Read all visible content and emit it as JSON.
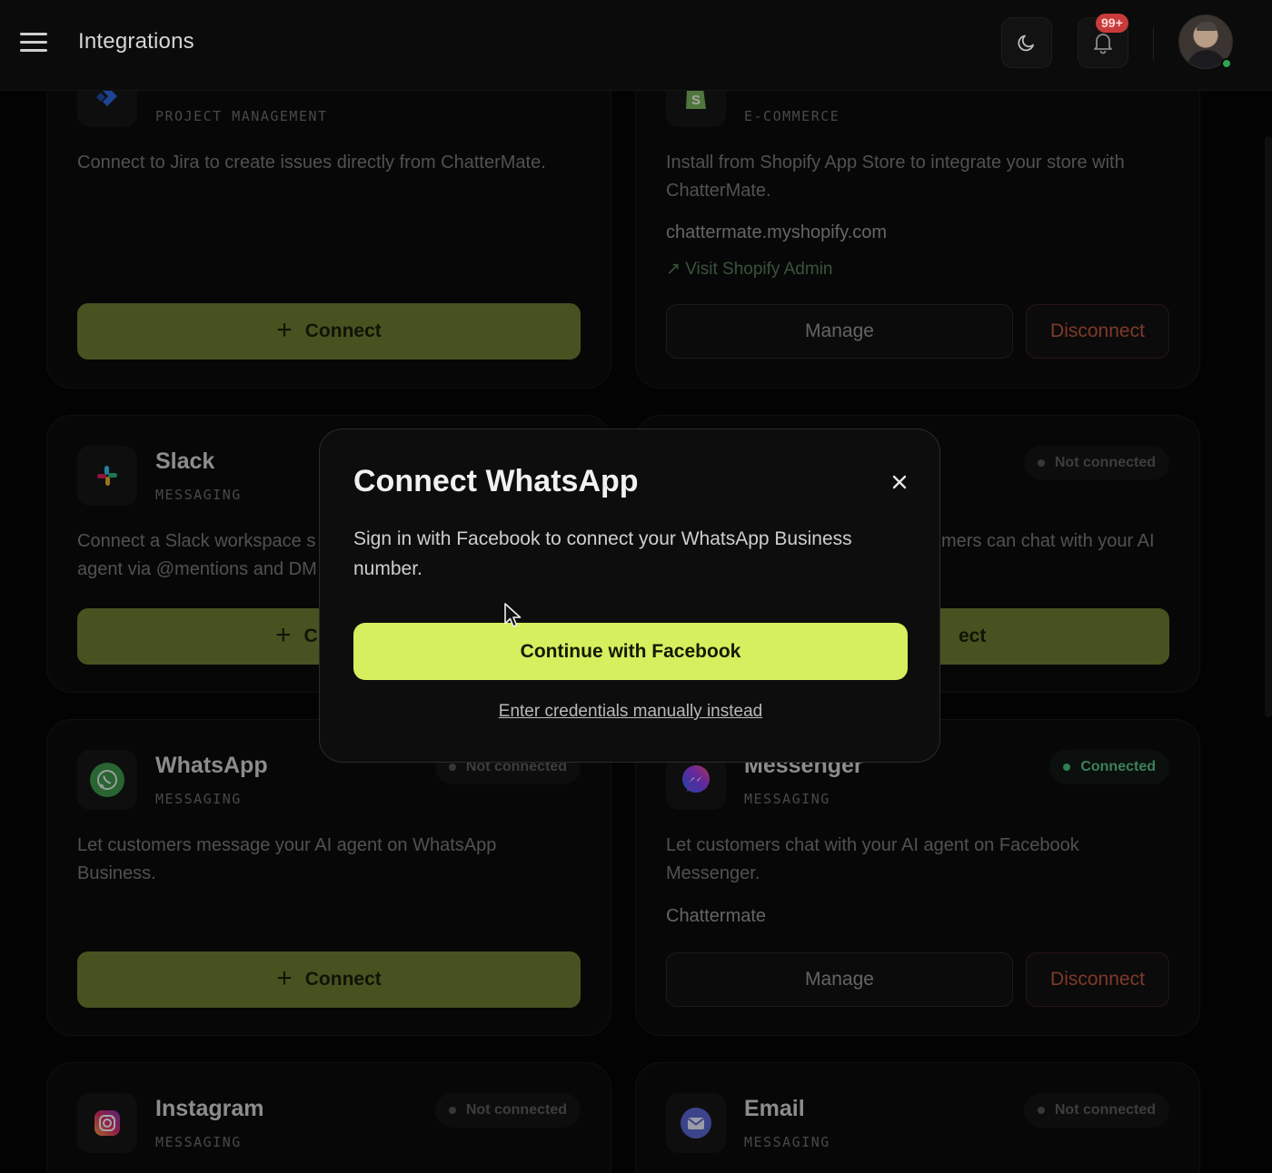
{
  "header": {
    "title": "Integrations",
    "notifications_badge": "99+"
  },
  "cards": {
    "jira": {
      "category": "PROJECT MANAGEMENT",
      "description": "Connect to Jira to create issues directly from ChatterMate.",
      "connect_label": "Connect"
    },
    "shopify": {
      "category": "E-COMMERCE",
      "description": "Install from Shopify App Store to integrate your store with ChatterMate.",
      "account": "chattermate.myshopify.com",
      "link_label": "Visit Shopify Admin",
      "manage_label": "Manage",
      "disconnect_label": "Disconnect"
    },
    "slack": {
      "name": "Slack",
      "category": "MESSAGING",
      "description": "Connect a Slack workspace s agent via @mentions and DM",
      "connect_label": "C"
    },
    "hidden_right": {
      "status": "Not connected",
      "description": "mers can chat with your AI",
      "connect_label": "ect"
    },
    "whatsapp": {
      "name": "WhatsApp",
      "category": "MESSAGING",
      "status": "Not connected",
      "description": "Let customers message your AI agent on WhatsApp Business.",
      "connect_label": "Connect"
    },
    "messenger": {
      "name": "Messenger",
      "category": "MESSAGING",
      "status": "Connected",
      "description": "Let customers chat with your AI agent on Facebook Messenger.",
      "account": "Chattermate",
      "manage_label": "Manage",
      "disconnect_label": "Disconnect"
    },
    "instagram": {
      "name": "Instagram",
      "category": "MESSAGING",
      "status": "Not connected"
    },
    "email": {
      "name": "Email",
      "category": "MESSAGING",
      "status": "Not connected"
    }
  },
  "modal": {
    "title": "Connect WhatsApp",
    "description": "Sign in with Facebook to connect your WhatsApp Business number.",
    "primary_label": "Continue with Facebook",
    "secondary_link": "Enter credentials manually instead"
  },
  "colors": {
    "accent": "#d5ef5f",
    "connect_button": "#6f7e33",
    "danger": "#c3583f",
    "connected": "#4cc27c"
  },
  "icons": [
    "menu-icon",
    "moon-icon",
    "bell-icon",
    "close-icon",
    "cursor-icon",
    "arrow-up-right-icon"
  ]
}
